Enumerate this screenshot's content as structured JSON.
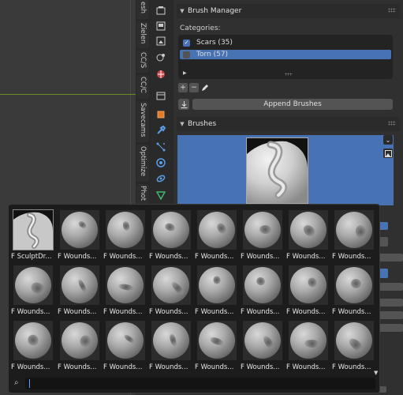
{
  "sidebar_tabs": [
    "esh",
    "Zielen",
    "CC/S",
    "CC/C",
    "Savecams",
    "Optimize",
    "Phot"
  ],
  "tool_icons": [
    "scene-icon",
    "render-icon",
    "output-icon",
    "view-layer-icon",
    "world-icon",
    "collection-icon",
    "object-icon",
    "modifier-icon",
    "particles-icon",
    "physics-icon",
    "constraints-icon",
    "data-icon"
  ],
  "brush_manager": {
    "title": "Brush Manager",
    "categories_label": "Categories:",
    "categories": [
      {
        "label": "Scars (35)",
        "checked": true,
        "selected": false
      },
      {
        "label": "Torn (57)",
        "checked": false,
        "selected": true
      }
    ],
    "expand_icon": "play-triangle-icon",
    "add_label": "+",
    "remove_label": "−",
    "append_label": "Append Brushes"
  },
  "brushes": {
    "title": "Brushes"
  },
  "popup": {
    "items": [
      "F SculptDr...",
      "F Wounds...",
      "F Wounds...",
      "F Wounds...",
      "F Wounds...",
      "F Wounds...",
      "F Wounds...",
      "F Wounds...",
      "F Wounds...",
      "F Wounds...",
      "F Wounds...",
      "F Wounds...",
      "F Wounds...",
      "F Wounds...",
      "F Wounds...",
      "F Wounds...",
      "F Wounds...",
      "F Wounds...",
      "F Wounds...",
      "F Wounds...",
      "F Wounds...",
      "F Wounds...",
      "F Wounds...",
      "F Wounds..."
    ],
    "search_value": "",
    "search_icon": "search-icon"
  },
  "colors": {
    "accent": "#4772b3",
    "panel": "#303030",
    "popup": "#1c1c1c"
  }
}
